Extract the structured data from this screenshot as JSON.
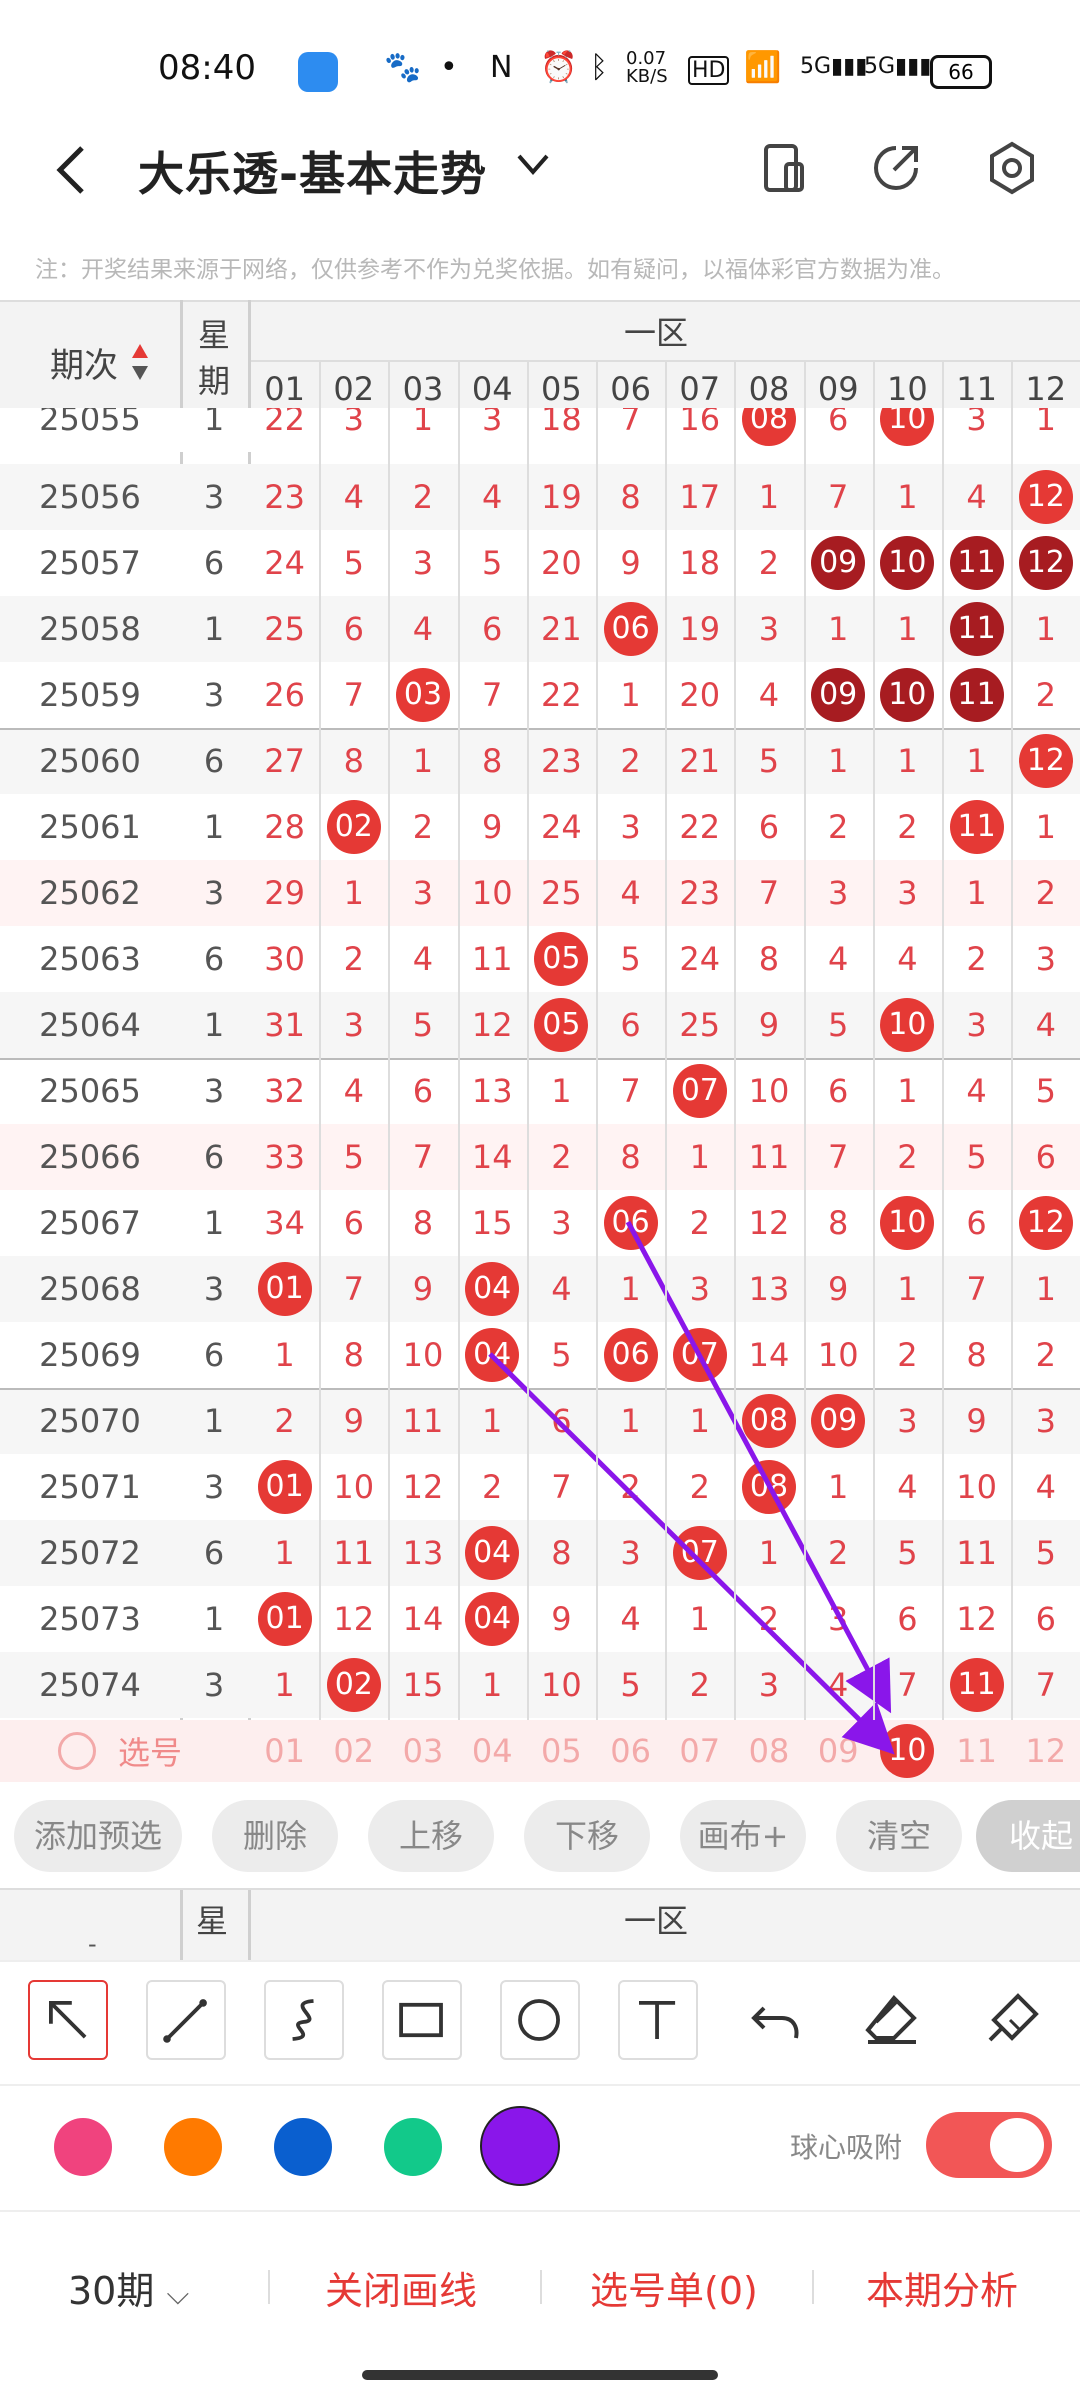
{
  "status": {
    "time": "08:40",
    "net_speed": "0.07\nKB/S",
    "battery": "66"
  },
  "header": {
    "title": "大乐透-基本走势",
    "chevron": "⌄"
  },
  "notice": "注：开奖结果来源于网络，仅供参考不作为兑奖依据。如有疑问，以福体彩官方数据为准。",
  "table": {
    "col_issue": "期次",
    "col_week": "星期",
    "zone": "一区",
    "numbers": [
      "01",
      "02",
      "03",
      "04",
      "05",
      "06",
      "07",
      "08",
      "09",
      "10",
      "11",
      "12"
    ],
    "rows": [
      {
        "issue": "25055",
        "week": "1",
        "cells": [
          "22",
          "3",
          "1",
          "3",
          "18",
          "7",
          "16",
          "08",
          "6",
          "10",
          "3",
          "1"
        ],
        "hits": [
          7,
          9
        ]
      },
      {
        "issue": "25056",
        "week": "3",
        "cells": [
          "23",
          "4",
          "2",
          "4",
          "19",
          "8",
          "17",
          "1",
          "7",
          "1",
          "4",
          "12"
        ],
        "hits": [
          11
        ]
      },
      {
        "issue": "25057",
        "week": "6",
        "cells": [
          "24",
          "5",
          "3",
          "5",
          "20",
          "9",
          "18",
          "2",
          "09",
          "10",
          "11",
          "12"
        ],
        "hits": [
          8,
          9,
          10,
          11
        ],
        "dark": [
          8,
          9,
          10,
          11
        ]
      },
      {
        "issue": "25058",
        "week": "1",
        "cells": [
          "25",
          "6",
          "4",
          "6",
          "21",
          "06",
          "19",
          "3",
          "1",
          "1",
          "11",
          "1"
        ],
        "hits": [
          5,
          10
        ],
        "dark": [
          10
        ]
      },
      {
        "issue": "25059",
        "week": "3",
        "cells": [
          "26",
          "7",
          "03",
          "7",
          "22",
          "1",
          "20",
          "4",
          "09",
          "10",
          "11",
          "2"
        ],
        "hits": [
          2,
          8,
          9,
          10
        ],
        "dark": [
          8,
          9,
          10
        ]
      },
      {
        "issue": "25060",
        "week": "6",
        "cells": [
          "27",
          "8",
          "1",
          "8",
          "23",
          "2",
          "21",
          "5",
          "1",
          "1",
          "1",
          "12"
        ],
        "hits": [
          11
        ]
      },
      {
        "issue": "25061",
        "week": "1",
        "cells": [
          "28",
          "02",
          "2",
          "9",
          "24",
          "3",
          "22",
          "6",
          "2",
          "2",
          "11",
          "1"
        ],
        "hits": [
          1,
          10
        ]
      },
      {
        "issue": "25062",
        "week": "3",
        "cells": [
          "29",
          "1",
          "3",
          "10",
          "25",
          "4",
          "23",
          "7",
          "3",
          "3",
          "1",
          "2"
        ],
        "hits": []
      },
      {
        "issue": "25063",
        "week": "6",
        "cells": [
          "30",
          "2",
          "4",
          "11",
          "05",
          "5",
          "24",
          "8",
          "4",
          "4",
          "2",
          "3"
        ],
        "hits": [
          4
        ]
      },
      {
        "issue": "25064",
        "week": "1",
        "cells": [
          "31",
          "3",
          "5",
          "12",
          "05",
          "6",
          "25",
          "9",
          "5",
          "10",
          "3",
          "4"
        ],
        "hits": [
          4,
          9
        ]
      },
      {
        "issue": "25065",
        "week": "3",
        "cells": [
          "32",
          "4",
          "6",
          "13",
          "1",
          "7",
          "07",
          "10",
          "6",
          "1",
          "4",
          "5"
        ],
        "hits": [
          6
        ]
      },
      {
        "issue": "25066",
        "week": "6",
        "cells": [
          "33",
          "5",
          "7",
          "14",
          "2",
          "8",
          "1",
          "11",
          "7",
          "2",
          "5",
          "6"
        ],
        "hits": []
      },
      {
        "issue": "25067",
        "week": "1",
        "cells": [
          "34",
          "6",
          "8",
          "15",
          "3",
          "06",
          "2",
          "12",
          "8",
          "10",
          "6",
          "12"
        ],
        "hits": [
          5,
          9,
          11
        ]
      },
      {
        "issue": "25068",
        "week": "3",
        "cells": [
          "01",
          "7",
          "9",
          "04",
          "4",
          "1",
          "3",
          "13",
          "9",
          "1",
          "7",
          "1"
        ],
        "hits": [
          0,
          3
        ]
      },
      {
        "issue": "25069",
        "week": "6",
        "cells": [
          "1",
          "8",
          "10",
          "04",
          "5",
          "06",
          "07",
          "14",
          "10",
          "2",
          "8",
          "2"
        ],
        "hits": [
          3,
          5,
          6
        ]
      },
      {
        "issue": "25070",
        "week": "1",
        "cells": [
          "2",
          "9",
          "11",
          "1",
          "6",
          "1",
          "1",
          "08",
          "09",
          "3",
          "9",
          "3"
        ],
        "hits": [
          7,
          8
        ]
      },
      {
        "issue": "25071",
        "week": "3",
        "cells": [
          "01",
          "10",
          "12",
          "2",
          "7",
          "2",
          "2",
          "08",
          "1",
          "4",
          "10",
          "4"
        ],
        "hits": [
          0,
          7
        ]
      },
      {
        "issue": "25072",
        "week": "6",
        "cells": [
          "1",
          "11",
          "13",
          "04",
          "8",
          "3",
          "07",
          "1",
          "2",
          "5",
          "11",
          "5"
        ],
        "hits": [
          3,
          6
        ]
      },
      {
        "issue": "25073",
        "week": "1",
        "cells": [
          "01",
          "12",
          "14",
          "04",
          "9",
          "4",
          "1",
          "2",
          "3",
          "6",
          "12",
          "6"
        ],
        "hits": [
          0,
          3
        ]
      },
      {
        "issue": "25074",
        "week": "3",
        "cells": [
          "1",
          "02",
          "15",
          "1",
          "10",
          "5",
          "2",
          "3",
          "4",
          "7",
          "11",
          "7"
        ],
        "hits": [
          1,
          10
        ]
      }
    ]
  },
  "select_row": {
    "label": "选号",
    "numbers": [
      "01",
      "02",
      "03",
      "04",
      "05",
      "06",
      "07",
      "08",
      "09",
      "10",
      "11",
      "12"
    ],
    "selected_index": 9
  },
  "actions": [
    "添加预选",
    "删除",
    "上移",
    "下移",
    "画布+",
    "清空",
    "收起"
  ],
  "second_header": {
    "week": "星",
    "zone": "一区"
  },
  "tools": [
    "select-arrow-icon",
    "line-icon",
    "curve-icon",
    "rectangle-icon",
    "circle-icon",
    "text-icon",
    "undo-icon",
    "eraser-icon",
    "clear-brush-icon"
  ],
  "colors": [
    "#f0437e",
    "#ff7a00",
    "#0a5fcf",
    "#12c98a",
    "#8a16ea"
  ],
  "snap": {
    "label": "球心吸附",
    "on": true
  },
  "bottom": {
    "period": "30期",
    "close_draw": "关闭画线",
    "pick_list": "选号单(0)",
    "analysis": "本期分析"
  }
}
